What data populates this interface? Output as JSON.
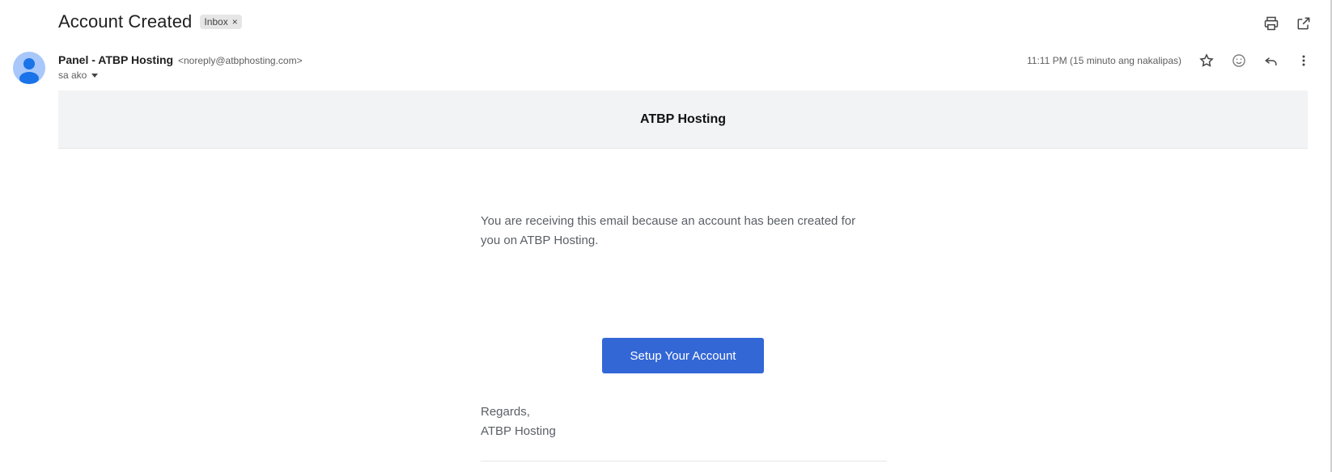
{
  "subject": "Account Created",
  "label": {
    "text": "Inbox",
    "close_glyph": "×"
  },
  "top_actions": {
    "print_icon": "print-icon",
    "open_new_window_icon": "open-in-new-window-icon"
  },
  "sender": {
    "name": "Panel - ATBP Hosting",
    "email": "<noreply@atbphosting.com>",
    "to": "sa ako"
  },
  "meta": {
    "timestamp": "11:11 PM (15 minuto ang nakalipas)",
    "icons": [
      "star-icon",
      "emoji-icon",
      "reply-icon",
      "more-vert-icon"
    ]
  },
  "email": {
    "banner_title": "ATBP Hosting",
    "body": "You are receiving this email because an account has been created for you on ATBP Hosting.",
    "button_label": "Setup Your Account",
    "regards": "Regards,",
    "signature": "ATBP Hosting"
  },
  "colors": {
    "button": "#3367d6",
    "banner": "#f2f3f5",
    "avatar": "#a8c7fa"
  }
}
